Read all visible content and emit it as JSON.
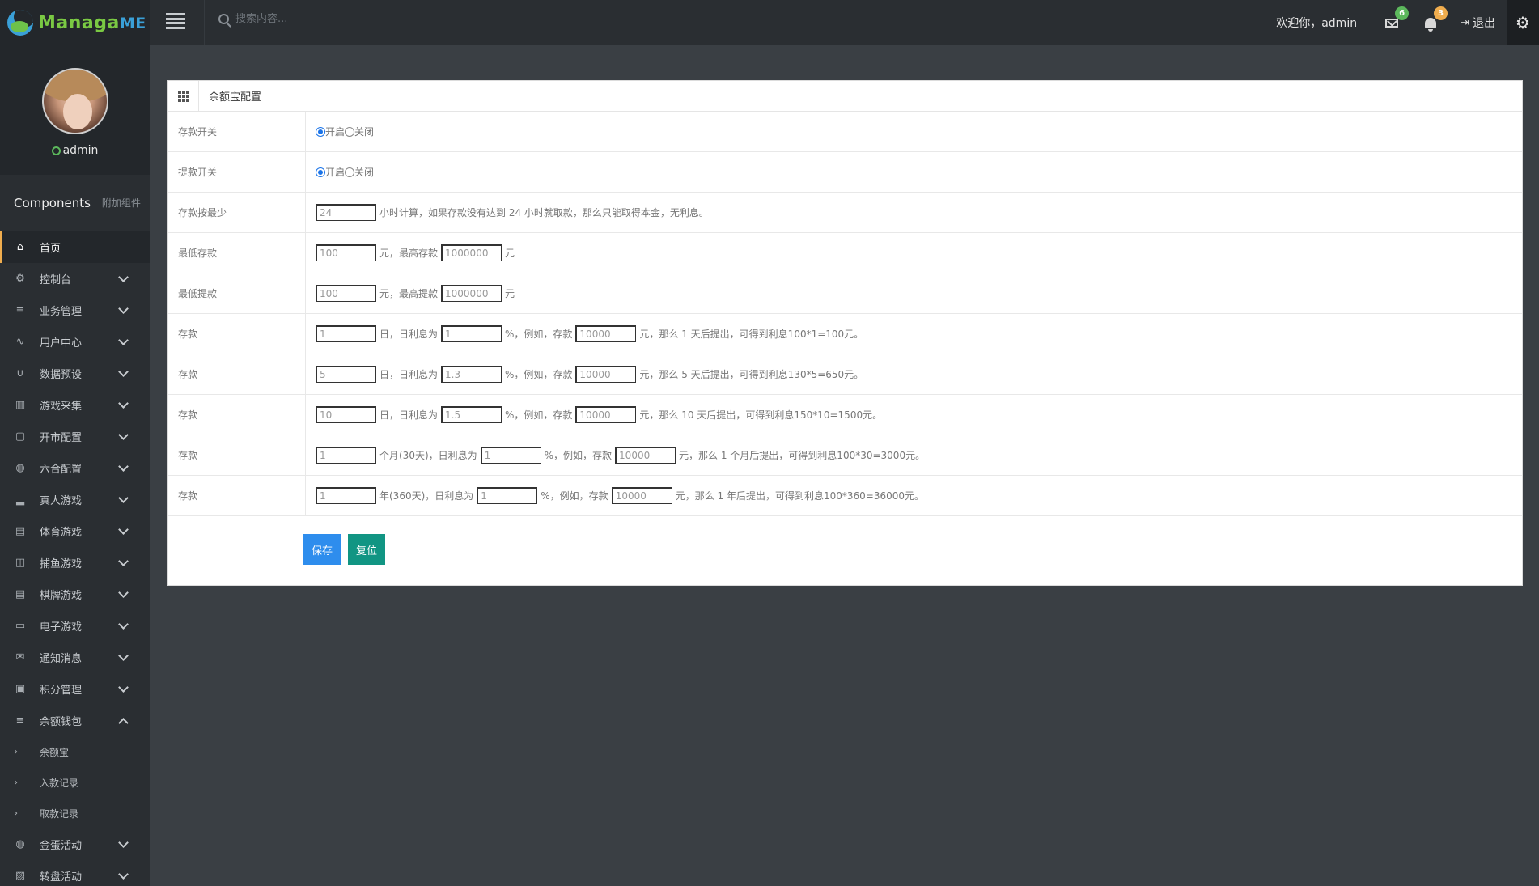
{
  "header": {
    "logo_main": "Managa",
    "logo_tail": "ME",
    "search_placeholder": "搜索内容...",
    "welcome": "欢迎你，admin",
    "messages_badge": "6",
    "notifications_badge": "3",
    "logout_label": "退出",
    "icons": [
      "menu-icon",
      "search-icon",
      "envelope-icon",
      "bell-icon",
      "sign-out-icon",
      "gear-icon"
    ]
  },
  "sidebar": {
    "username": "admin",
    "components_title": "Components",
    "components_sub": "附加组件",
    "items": [
      {
        "label": "首页",
        "icon": "home-icon",
        "glyph": "⌂",
        "active": true,
        "caret": ""
      },
      {
        "label": "控制台",
        "icon": "gear-icon",
        "glyph": "⚙",
        "caret": "down"
      },
      {
        "label": "业务管理",
        "icon": "list-icon",
        "glyph": "≡",
        "caret": "down"
      },
      {
        "label": "用户中心",
        "icon": "pulse-icon",
        "glyph": "∿",
        "caret": "down"
      },
      {
        "label": "数据预设",
        "icon": "magnet-icon",
        "glyph": "∪",
        "caret": "down"
      },
      {
        "label": "游戏采集",
        "icon": "columns-icon",
        "glyph": "▥",
        "caret": "down"
      },
      {
        "label": "开市配置",
        "icon": "clipboard-icon",
        "glyph": "▢",
        "caret": "down"
      },
      {
        "label": "六合配置",
        "icon": "globe-icon",
        "glyph": "◍",
        "caret": "down"
      },
      {
        "label": "真人游戏",
        "icon": "bar-chart-icon",
        "glyph": "▂",
        "caret": "down"
      },
      {
        "label": "体育游戏",
        "icon": "calendar-icon",
        "glyph": "▤",
        "caret": "down"
      },
      {
        "label": "捕鱼游戏",
        "icon": "layout-icon",
        "glyph": "◫",
        "caret": "down"
      },
      {
        "label": "棋牌游戏",
        "icon": "calendar-icon",
        "glyph": "▤",
        "caret": "down"
      },
      {
        "label": "电子游戏",
        "icon": "window-icon",
        "glyph": "▭",
        "caret": "down"
      },
      {
        "label": "通知消息",
        "icon": "mail-icon",
        "glyph": "✉",
        "caret": "down"
      },
      {
        "label": "积分管理",
        "icon": "id-card-icon",
        "glyph": "▣",
        "caret": "down"
      },
      {
        "label": "余额钱包",
        "icon": "list-icon",
        "glyph": "≡",
        "caret": "up"
      }
    ],
    "sub_items": [
      "余额宝",
      "入款记录",
      "取款记录"
    ],
    "bottom_items": [
      {
        "label": "金蛋活动",
        "icon": "globe-icon",
        "glyph": "◍",
        "caret": "down"
      },
      {
        "label": "转盘活动",
        "icon": "image-icon",
        "glyph": "▨",
        "caret": "down"
      }
    ]
  },
  "panel": {
    "title": "余额宝配置",
    "rows": {
      "deposit_switch": {
        "label": "存款开关",
        "on": "开启",
        "off": "关闭",
        "selected": "on"
      },
      "withdraw_switch": {
        "label": "提款开关",
        "on": "开启",
        "off": "关闭",
        "selected": "on"
      },
      "min_hours": {
        "label": "存款按最少",
        "value": "24",
        "text": "小时计算，如果存款没有达到 24 小时就取款，那么只能取得本金，无利息。"
      },
      "min_deposit": {
        "label": "最低存款",
        "value": "100",
        "t1": "元，最高存款",
        "max": "1000000",
        "t2": "元"
      },
      "min_withdraw": {
        "label": "最低提款",
        "value": "100",
        "t1": "元，最高提款",
        "max": "1000000",
        "t2": "元"
      },
      "plan1": {
        "label": "存款",
        "period": "1",
        "t1": "日，日利息为",
        "rate": "1",
        "t2": "%，例如，存款",
        "amount": "10000",
        "t3": "元，那么 1 天后提出，可得到利息100*1=100元。"
      },
      "plan2": {
        "label": "存款",
        "period": "5",
        "t1": "日，日利息为",
        "rate": "1.3",
        "t2": "%，例如，存款",
        "amount": "10000",
        "t3": "元，那么 5 天后提出，可得到利息130*5=650元。"
      },
      "plan3": {
        "label": "存款",
        "period": "10",
        "t1": "日，日利息为",
        "rate": "1.5",
        "t2": "%，例如，存款",
        "amount": "10000",
        "t3": "元，那么 10 天后提出，可得到利息150*10=1500元。"
      },
      "plan4": {
        "label": "存款",
        "period": "1",
        "t1": "个月(30天)，日利息为",
        "rate": "1",
        "t2": "%，例如，存款",
        "amount": "10000",
        "t3": "元，那么 1 个月后提出，可得到利息100*30=3000元。"
      },
      "plan5": {
        "label": "存款",
        "period": "1",
        "t1": "年(360天)，日利息为",
        "rate": "1",
        "t2": "%，例如，存款",
        "amount": "10000",
        "t3": "元，那么 1 年后提出，可得到利息100*360=36000元。"
      }
    },
    "save_label": "保存",
    "reset_label": "复位"
  },
  "colors": {
    "accent_active": "#f0ad4e",
    "save_button": "#2e8ded",
    "reset_button": "#119583",
    "badge_messages": "#5cb85c",
    "badge_notifications": "#f0ad4e"
  }
}
